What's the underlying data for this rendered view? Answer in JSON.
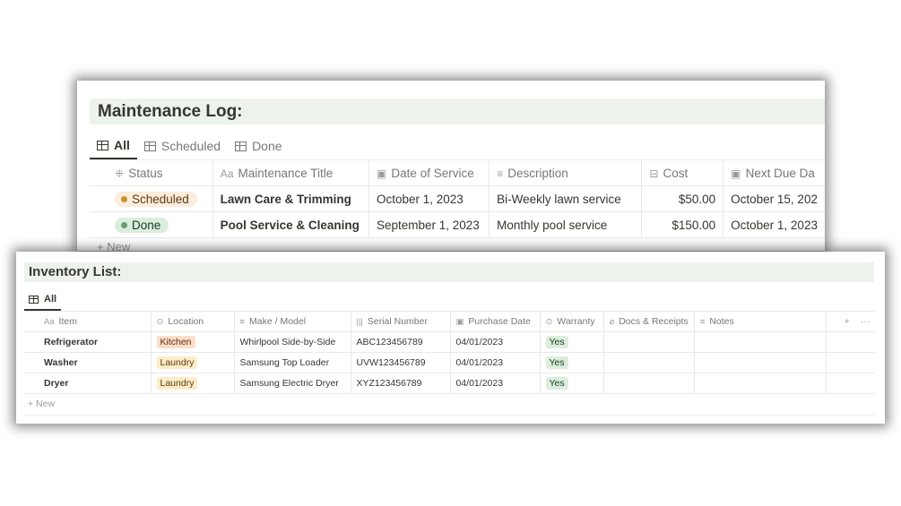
{
  "maintenance": {
    "title": "Maintenance Log:",
    "tabs": [
      {
        "label": "All",
        "active": true
      },
      {
        "label": "Scheduled",
        "active": false
      },
      {
        "label": "Done",
        "active": false
      }
    ],
    "columns": [
      {
        "icon": "status-icon",
        "glyph": "⁜",
        "label": "Status"
      },
      {
        "icon": "text-property-icon",
        "glyph": "Aa",
        "label": "Maintenance Title"
      },
      {
        "icon": "calendar-icon",
        "glyph": "▣",
        "label": "Date of Service"
      },
      {
        "icon": "lines-icon",
        "glyph": "≡",
        "label": "Description"
      },
      {
        "icon": "money-icon",
        "glyph": "⊟",
        "label": "Cost"
      },
      {
        "icon": "calendar-icon",
        "glyph": "▣",
        "label": "Next Due Da"
      }
    ],
    "rows": [
      {
        "status": "Scheduled",
        "title": "Lawn Care & Trimming",
        "date": "October 1, 2023",
        "description": "Bi-Weekly lawn service",
        "cost": "$50.00",
        "next_due": "October 15, 202"
      },
      {
        "status": "Done",
        "title": "Pool Service & Cleaning",
        "date": "September 1, 2023",
        "description": "Monthly pool service",
        "cost": "$150.00",
        "next_due": "October 1, 2023"
      }
    ],
    "new_label": "+ New"
  },
  "inventory": {
    "title": "Inventory List:",
    "tabs": [
      {
        "label": "All",
        "active": true
      }
    ],
    "columns": [
      {
        "icon": "text-property-icon",
        "glyph": "Aa",
        "label": "Item"
      },
      {
        "icon": "select-icon",
        "glyph": "⊙",
        "label": "Location"
      },
      {
        "icon": "lines-icon",
        "glyph": "≡",
        "label": "Make / Model"
      },
      {
        "icon": "barcode-icon",
        "glyph": "|||",
        "label": "Serial Number"
      },
      {
        "icon": "calendar-icon",
        "glyph": "▣",
        "label": "Purchase Date"
      },
      {
        "icon": "select-icon",
        "glyph": "⊙",
        "label": "Warranty"
      },
      {
        "icon": "paperclip-icon",
        "glyph": "⌀",
        "label": "Docs & Receipts"
      },
      {
        "icon": "lines-icon",
        "glyph": "≡",
        "label": "Notes"
      }
    ],
    "add_column": "+",
    "more_options": "···",
    "rows": [
      {
        "item": "Refrigerator",
        "location": "Kitchen",
        "model": "Whirlpool Side-by-Side",
        "serial": "ABC123456789",
        "purchase_date": "04/01/2023",
        "warranty": "Yes"
      },
      {
        "item": "Washer",
        "location": "Laundry",
        "model": "Samsung Top Loader",
        "serial": "UVW123456789",
        "purchase_date": "04/01/2023",
        "warranty": "Yes"
      },
      {
        "item": "Dryer",
        "location": "Laundry",
        "model": "Samsung Electric Dryer",
        "serial": "XYZ123456789",
        "purchase_date": "04/01/2023",
        "warranty": "Yes"
      }
    ],
    "new_label": "+ New"
  },
  "colors": {
    "title_bg": "#edf2ec",
    "status_scheduled_bg": "#fbecdd",
    "status_scheduled_dot": "#cb912f",
    "status_done_bg": "#dbeddb",
    "status_done_dot": "#6c9b7d",
    "tag_kitchen_bg": "#fadec9",
    "tag_laundry_bg": "#fdecc8",
    "tag_yes_bg": "#dbeddb"
  }
}
